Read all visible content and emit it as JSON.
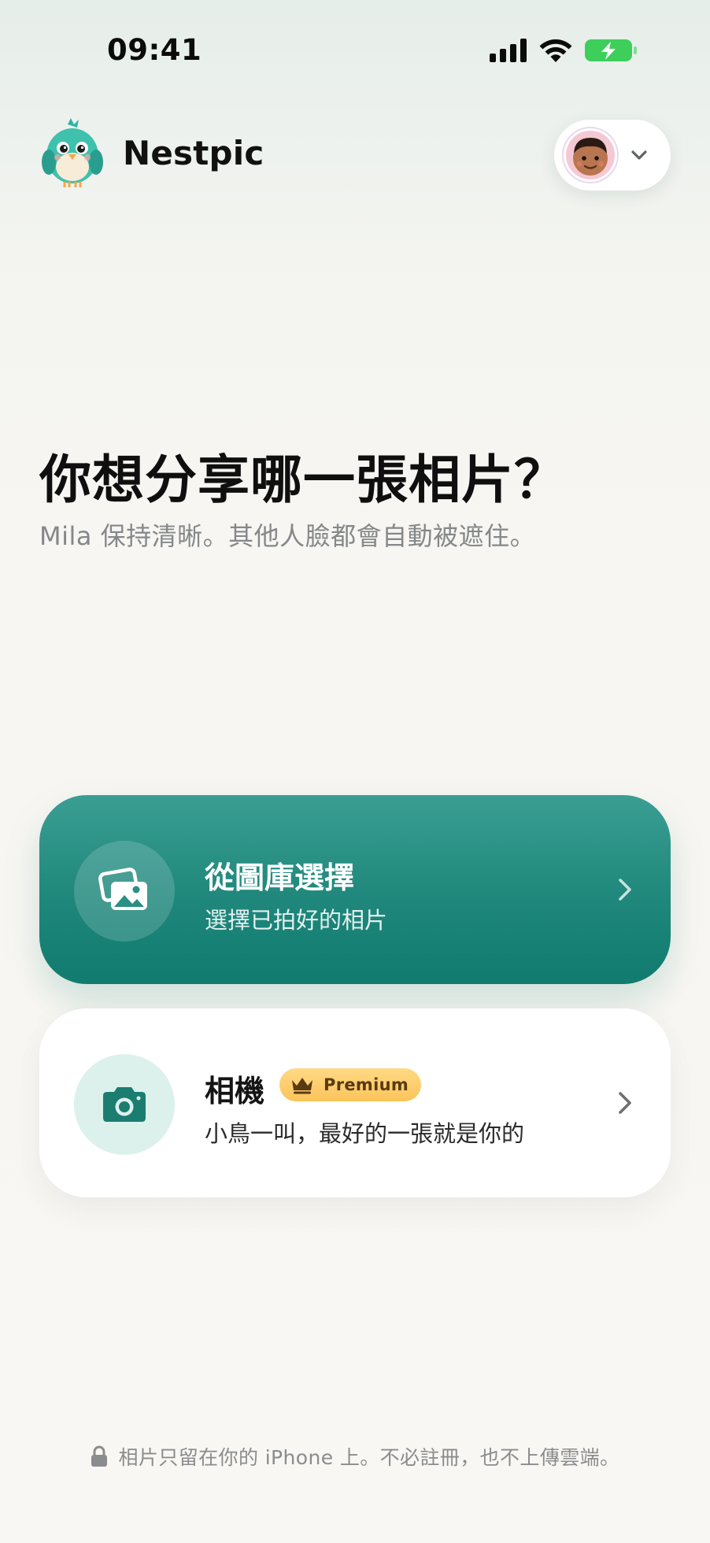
{
  "status_bar": {
    "time": "09:41",
    "signal_icon": "cellular-signal-icon",
    "wifi_icon": "wifi-icon",
    "battery_icon": "battery-charging-icon",
    "battery_color": "#3ecf5b"
  },
  "header": {
    "app_name": "Nestpic",
    "logo_icon": "bird-mascot-icon",
    "profile_icon": "avatar",
    "switch_icon": "chevron-down-icon"
  },
  "main": {
    "title": "你想分享哪一張相片？",
    "subtitle": "Mila 保持清晰。其他人臉都會自動被遮住。"
  },
  "options": {
    "gallery": {
      "title": "從圖庫選擇",
      "subtitle": "選擇已拍好的相片",
      "icon": "photo-library-icon",
      "accent": "#117b6f"
    },
    "camera": {
      "title": "相機",
      "badge": "Premium",
      "badge_icon": "crown-icon",
      "subtitle": "小鳥一叫，最好的一張就是你的",
      "icon": "camera-icon",
      "accent": "#1a7d70"
    }
  },
  "footer": {
    "icon": "lock-icon",
    "text": "相片只留在你的 iPhone 上。不必註冊，也不上傳雲端。"
  }
}
